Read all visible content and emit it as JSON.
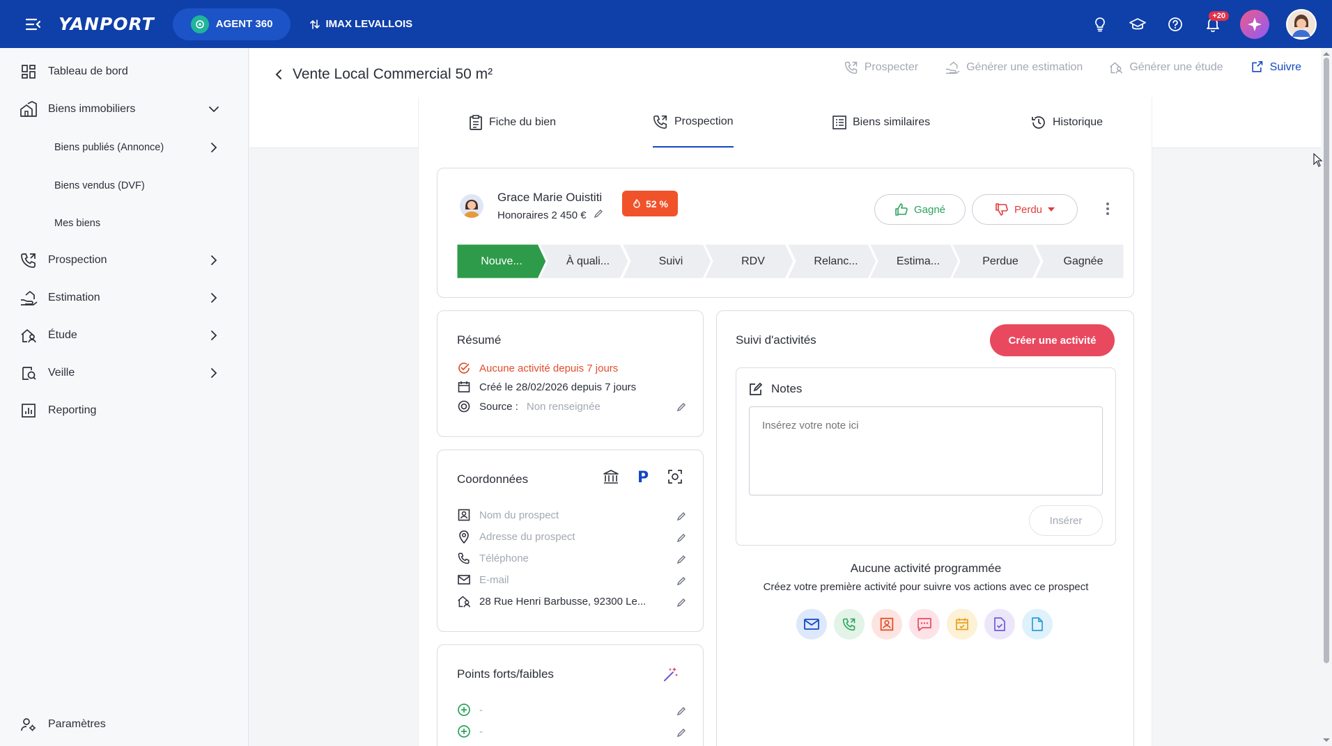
{
  "topbar": {
    "logo": "YANPORT",
    "agent_label": "AGENT 360",
    "agency_label": "IMAX LEVALLOIS",
    "notif_badge": "+20",
    "accent": "#0f3fa8"
  },
  "sidebar": {
    "items": [
      {
        "label": "Tableau de bord",
        "icon": "dashboard-icon"
      },
      {
        "label": "Biens immobiliers",
        "icon": "buildings-icon"
      },
      {
        "label": "Biens publiés (Annonce)"
      },
      {
        "label": "Biens vendus (DVF)"
      },
      {
        "label": "Mes biens"
      },
      {
        "label": "Prospection",
        "icon": "phone-call-icon"
      },
      {
        "label": "Estimation",
        "icon": "hand-house-icon"
      },
      {
        "label": "Étude",
        "icon": "house-person-icon"
      },
      {
        "label": "Veille",
        "icon": "watch-icon"
      },
      {
        "label": "Reporting",
        "icon": "report-icon"
      },
      {
        "label": "Paramètres",
        "icon": "settings-user-icon"
      }
    ]
  },
  "header": {
    "title": "Vente Local Commercial 50 m²",
    "actions": {
      "prospecter": "Prospecter",
      "estimation": "Générer une estimation",
      "etude": "Générer une étude",
      "suivre": "Suivre"
    },
    "tabs": [
      {
        "label": "Fiche du bien"
      },
      {
        "label": "Prospection"
      },
      {
        "label": "Biens similaires"
      },
      {
        "label": "Historique"
      }
    ]
  },
  "lead": {
    "name": "Grace Marie Ouistiti",
    "fees": "Honoraires 2 450 €",
    "score": "52 %",
    "won_label": "Gagné",
    "lost_label": "Perdu",
    "stages": [
      "Nouve...",
      "À quali...",
      "Suivi",
      "RDV",
      "Relanc...",
      "Estima...",
      "Perdue",
      "Gagnée"
    ],
    "active_stage_color": "#2e9b4a"
  },
  "resume": {
    "title": "Résumé",
    "no_activity": "Aucune activité depuis 7 jours",
    "created": "Créé le 28/02/2026 depuis 7 jours",
    "source_label": "Source :",
    "source_value": "Non renseignée"
  },
  "coordonnees": {
    "title": "Coordonnées",
    "name_ph": "Nom du prospect",
    "address_ph": "Adresse du prospect",
    "phone_ph": "Téléphone",
    "email_ph": "E-mail",
    "property_address": "28 Rue Henri Barbusse, 92300 Le..."
  },
  "points": {
    "title": "Points forts/faibles",
    "row1": "-",
    "row2": "-"
  },
  "activity": {
    "title": "Suivi d'activités",
    "create_label": "Créer une activité",
    "notes_title": "Notes",
    "notes_placeholder": "Insérez votre note ici",
    "insert_label": "Insérer",
    "empty_title": "Aucune activité programmée",
    "empty_sub": "Créez votre première activité pour suivre vos actions avec ce prospect"
  }
}
